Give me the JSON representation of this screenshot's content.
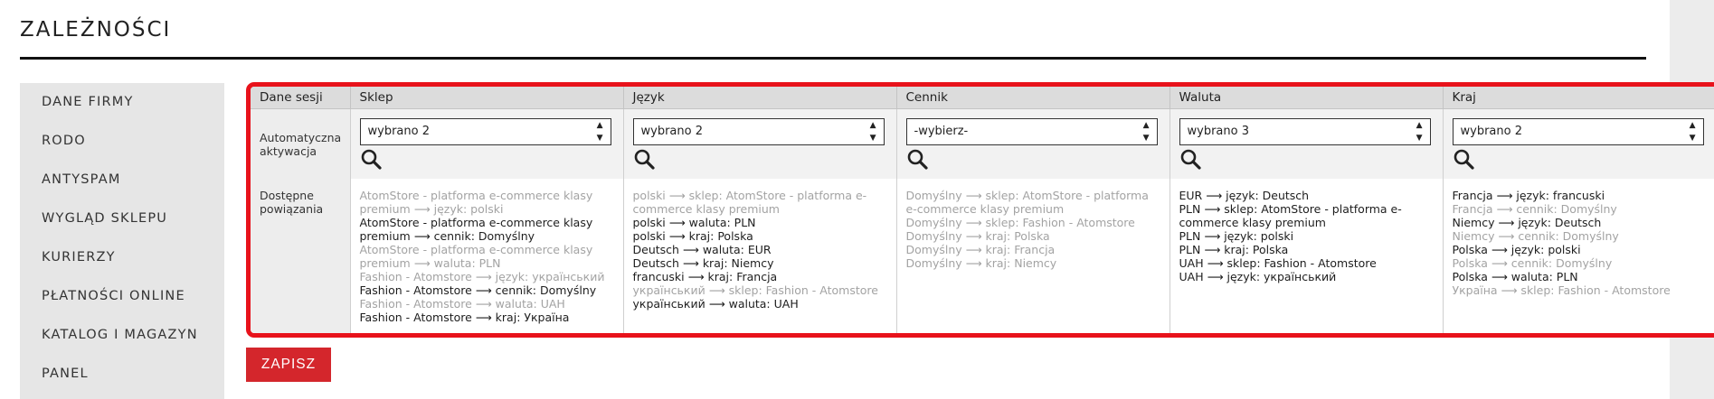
{
  "page": {
    "title": "ZALEŻNOŚCI"
  },
  "sidebar": {
    "items": [
      "DANE FIRMY",
      "RODO",
      "ANTYSPAM",
      "WYGLĄD SKLEPU",
      "KURIERZY",
      "PŁATNOŚCI ONLINE",
      "KATALOG I MAGAZYN",
      "PANEL"
    ]
  },
  "table": {
    "header_label": "Dane sesji",
    "auto_label": "Automatyczna aktywacja",
    "avail_label": "Dostępne powiązania",
    "columns": [
      {
        "name": "Sklep",
        "select_value": "wybrano 2",
        "icon": "search-icon",
        "deps": [
          {
            "text": "AtomStore - platforma e-commerce klasy premium ⟶ język: polski",
            "active": false
          },
          {
            "text": "AtomStore - platforma e-commerce klasy premium ⟶ cennik: Domyślny",
            "active": true
          },
          {
            "text": "AtomStore - platforma e-commerce klasy premium ⟶ waluta: PLN",
            "active": false
          },
          {
            "text": "Fashion - Atomstore ⟶ język: український",
            "active": false
          },
          {
            "text": "Fashion - Atomstore ⟶ cennik: Domyślny",
            "active": true
          },
          {
            "text": "Fashion - Atomstore ⟶ waluta: UAH",
            "active": false
          },
          {
            "text": "Fashion - Atomstore ⟶ kraj: Україна",
            "active": true
          }
        ]
      },
      {
        "name": "Język",
        "select_value": "wybrano 2",
        "icon": "search-icon",
        "deps": [
          {
            "text": "polski ⟶ sklep: AtomStore - platforma e-commerce klasy premium",
            "active": false
          },
          {
            "text": "polski ⟶ waluta: PLN",
            "active": true
          },
          {
            "text": "polski ⟶ kraj: Polska",
            "active": true
          },
          {
            "text": "Deutsch ⟶ waluta: EUR",
            "active": true
          },
          {
            "text": "Deutsch ⟶ kraj: Niemcy",
            "active": true
          },
          {
            "text": "francuski ⟶ kraj: Francja",
            "active": true
          },
          {
            "text": "український ⟶ sklep: Fashion - Atomstore",
            "active": false
          },
          {
            "text": "український ⟶ waluta: UAH",
            "active": true
          }
        ]
      },
      {
        "name": "Cennik",
        "select_value": "-wybierz-",
        "icon": "search-icon",
        "deps": [
          {
            "text": "Domyślny ⟶ sklep: AtomStore - platforma e-commerce klasy premium",
            "active": false
          },
          {
            "text": "Domyślny ⟶ sklep: Fashion - Atomstore",
            "active": false
          },
          {
            "text": "Domyślny ⟶ kraj: Polska",
            "active": false
          },
          {
            "text": "Domyślny ⟶ kraj: Francja",
            "active": false
          },
          {
            "text": "Domyślny ⟶ kraj: Niemcy",
            "active": false
          }
        ]
      },
      {
        "name": "Waluta",
        "select_value": "wybrano 3",
        "icon": "search-icon",
        "deps": [
          {
            "text": "EUR ⟶ język: Deutsch",
            "active": true
          },
          {
            "text": "PLN ⟶ sklep: AtomStore - platforma e-commerce klasy premium",
            "active": true
          },
          {
            "text": "PLN ⟶ język: polski",
            "active": true
          },
          {
            "text": "PLN ⟶ kraj: Polska",
            "active": true
          },
          {
            "text": "UAH ⟶ sklep: Fashion - Atomstore",
            "active": true
          },
          {
            "text": "UAH ⟶ język: український",
            "active": true
          }
        ]
      },
      {
        "name": "Kraj",
        "select_value": "wybrano 2",
        "icon": "search-icon",
        "deps": [
          {
            "text": "Francja ⟶ język: francuski",
            "active": true
          },
          {
            "text": "Francja ⟶ cennik: Domyślny",
            "active": false
          },
          {
            "text": "Niemcy ⟶ język: Deutsch",
            "active": true
          },
          {
            "text": "Niemcy ⟶ cennik: Domyślny",
            "active": false
          },
          {
            "text": "Polska ⟶ język: polski",
            "active": true
          },
          {
            "text": "Polska ⟶ cennik: Domyślny",
            "active": false
          },
          {
            "text": "Polska ⟶ waluta: PLN",
            "active": true
          },
          {
            "text": "Україна ⟶ sklep: Fashion - Atomstore",
            "active": false
          }
        ]
      }
    ]
  },
  "actions": {
    "save_label": "ZAPISZ"
  },
  "colors": {
    "accent": "#d4262c",
    "highlight_border": "#e8121b",
    "inactive_text": "#a3a3a3",
    "sidebar_bg": "#e6e6e6"
  }
}
